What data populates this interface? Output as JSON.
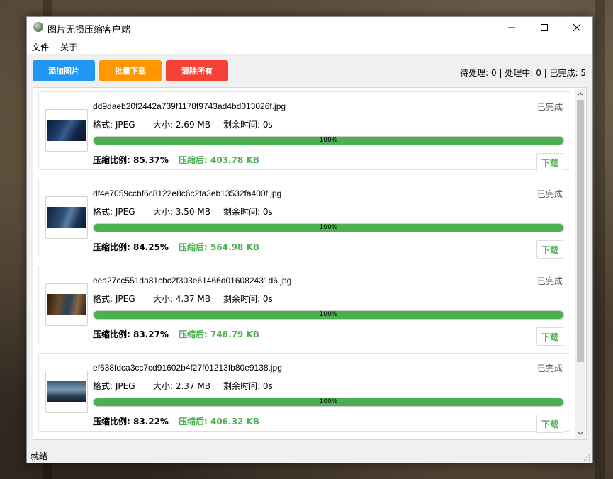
{
  "window": {
    "title": "图片无损压缩客户端"
  },
  "menu": {
    "file": "文件",
    "about": "关于"
  },
  "toolbar": {
    "add_label": "添加图片",
    "batch_label": "批量下载",
    "clear_label": "清除所有",
    "summary": "待处理: 0 | 处理中: 0 | 已完成: 5"
  },
  "colors": {
    "add": "#2196f3",
    "batch": "#ff9800",
    "clear": "#f44336",
    "progress": "#4caf50",
    "compressed_text": "#4caf50"
  },
  "icons": {
    "app": "app-logo-icon",
    "minimize": "minimize-icon",
    "maximize": "maximize-icon",
    "close": "close-icon",
    "scroll_up": "chevron-up-icon",
    "scroll_down": "chevron-down-icon",
    "grip": "resize-grip-icon"
  },
  "files": [
    {
      "name": "dd9daeb20f2442a739f1178f9743ad4bd013026f.jpg",
      "state": "已完成",
      "format": "格式: JPEG",
      "size": "大小: 2.69 MB",
      "remaining": "剩余时间: 0s",
      "progress": 1.0,
      "progress_text": "100%",
      "ratio": "压缩比例: 85.37%",
      "compressed": "压缩后: 403.78 KB",
      "download": "下载"
    },
    {
      "name": "df4e7059ccbf6c8122e8c6c2fa3eb13532fa400f.jpg",
      "state": "已完成",
      "format": "格式: JPEG",
      "size": "大小: 3.50 MB",
      "remaining": "剩余时间: 0s",
      "progress": 1.0,
      "progress_text": "100%",
      "ratio": "压缩比例: 84.25%",
      "compressed": "压缩后: 564.98 KB",
      "download": "下载"
    },
    {
      "name": "eea27cc551da81cbc2f303e61466d016082431d6.jpg",
      "state": "已完成",
      "format": "格式: JPEG",
      "size": "大小: 4.37 MB",
      "remaining": "剩余时间: 0s",
      "progress": 1.0,
      "progress_text": "100%",
      "ratio": "压缩比例: 83.27%",
      "compressed": "压缩后: 748.79 KB",
      "download": "下载"
    },
    {
      "name": "ef638fdca3cc7cd91602b4f27f01213fb80e9138.jpg",
      "state": "已完成",
      "format": "格式: JPEG",
      "size": "大小: 2.37 MB",
      "remaining": "剩余时间: 0s",
      "progress": 1.0,
      "progress_text": "100%",
      "ratio": "压缩比例: 83.22%",
      "compressed": "压缩后: 406.32 KB",
      "download": "下载"
    }
  ],
  "statusbar": {
    "text": "就绪"
  }
}
